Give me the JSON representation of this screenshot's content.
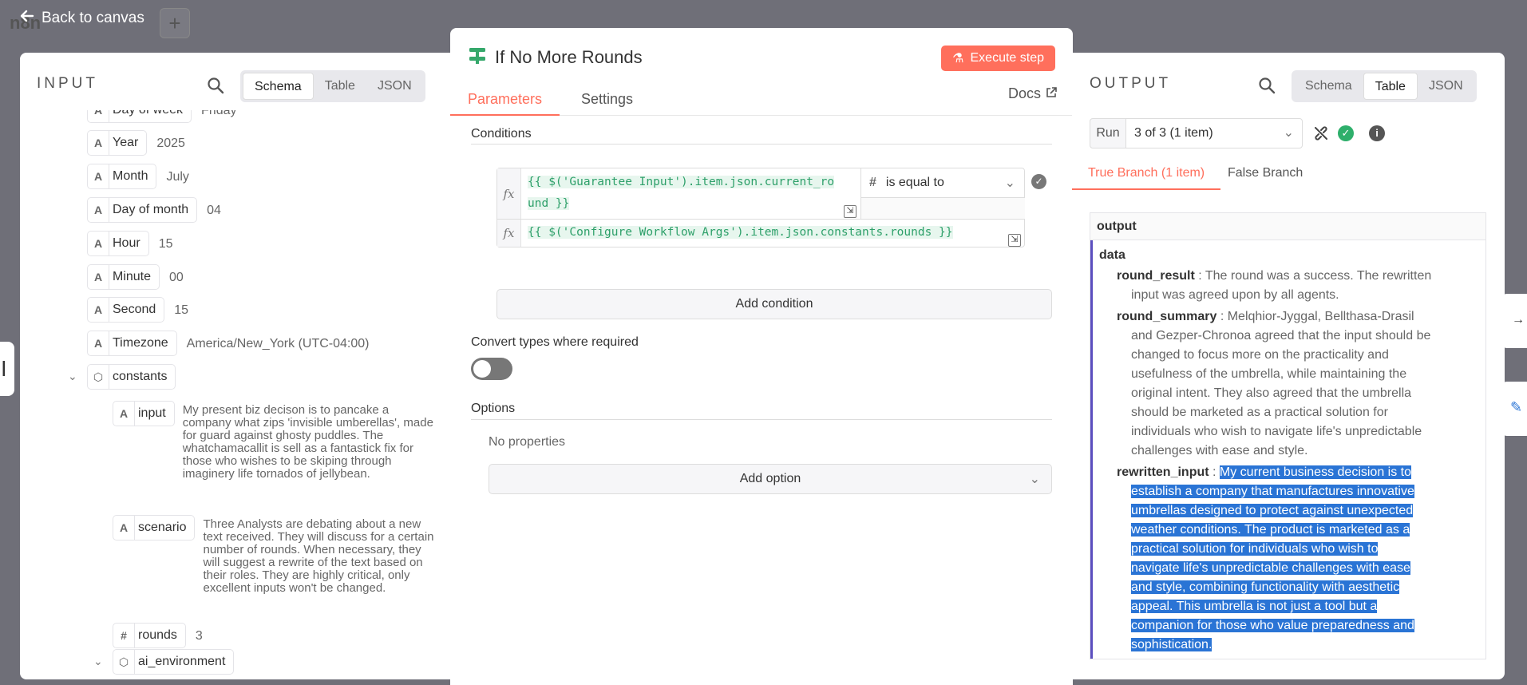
{
  "topbar": {
    "back_label": "Back to canvas",
    "bg_logo": "n8n"
  },
  "input": {
    "title": "INPUT",
    "tabs": [
      "Schema",
      "Table",
      "JSON"
    ],
    "active_tab": "Schema",
    "fields": [
      {
        "name": "Day of week",
        "value": "Friday"
      },
      {
        "name": "Year",
        "value": "2025"
      },
      {
        "name": "Month",
        "value": "July"
      },
      {
        "name": "Day of month",
        "value": "04"
      },
      {
        "name": "Hour",
        "value": "15"
      },
      {
        "name": "Minute",
        "value": "00"
      },
      {
        "name": "Second",
        "value": "15"
      },
      {
        "name": "Timezone",
        "value": "America/New_York (UTC-04:00)"
      }
    ],
    "constants": {
      "name": "constants",
      "input_name": "input",
      "input_value": "My present biz decison is to pancake a company what zips 'invisible umberellas', made for guard against ghosty puddles. The whatchamacallit is sell as a fantastick fix for those who wishes to be skiping through imaginery life tornados of jellybean.",
      "scenario_name": "scenario",
      "scenario_value": "Three Analysts are debating about a new text received. They will discuss for a certain number of rounds. When necessary, they will suggest a rewrite of the text based on their roles. They are highly critical, only excellent inputs won't be changed.",
      "rounds_name": "rounds",
      "rounds_value": "3"
    },
    "ai_environment": "ai_environment"
  },
  "node": {
    "title": "If No More Rounds",
    "execute_label": "Execute step",
    "tabs": [
      "Parameters",
      "Settings"
    ],
    "docs_label": "Docs",
    "conditions_label": "Conditions",
    "fx_label": "fx",
    "left_value_line1": "{{ $('Guarantee Input').item.json.current_ro",
    "left_value_line2": "und }}",
    "operator": "is equal to",
    "operator_type": "#",
    "right_value": "{{ $('Configure Workflow Args').item.json.constants.rounds }}",
    "add_condition_label": "Add condition",
    "convert_types_label": "Convert types where required",
    "convert_types_on": false,
    "options_label": "Options",
    "no_properties": "No properties",
    "add_option_label": "Add option"
  },
  "output": {
    "title": "OUTPUT",
    "tabs": [
      "Schema",
      "Table",
      "JSON"
    ],
    "active_tab": "Table",
    "run_label": "Run",
    "run_value": "3 of 3 (1 item)",
    "branches": [
      "True Branch (1 item)",
      "False Branch"
    ],
    "column": "output",
    "data_key": "data",
    "round_result_key": "round_result",
    "round_result_first": "The round was a success. The rewritten",
    "round_result_rest": [
      "input was agreed upon by all agents."
    ],
    "round_summary_key": "round_summary",
    "round_summary_first": "Melqhior-Jyggal, Bellthasa-Drasil",
    "round_summary_rest": [
      "and Gezper-Chronoa agreed that the input should be",
      "changed to focus more on the practicality and",
      "usefulness of the umbrella, while maintaining the",
      "original intent. They also agreed that the umbrella",
      "should be marketed as a practical solution for",
      "individuals who wish to navigate life's unpredictable",
      "challenges with ease and style."
    ],
    "rewritten_input_key": "rewritten_input",
    "rewritten_input_first": "My current business decision is to",
    "rewritten_input_rest": [
      "establish a company that manufactures innovative",
      "umbrellas designed to protect against unexpected",
      "weather conditions. The product is marketed as a",
      "practical solution for individuals who wish to",
      "navigate life's unpredictable challenges with ease",
      "and style, combining functionality with aesthetic",
      "appeal. This umbrella is not just a tool but a",
      "companion for those who value preparedness and",
      "sophistication."
    ]
  },
  "colors": {
    "accent": "#ff6f5c",
    "selection": "#2a74d5",
    "expr_green": "#2ea06a",
    "data_bar": "#5b4fbf"
  }
}
